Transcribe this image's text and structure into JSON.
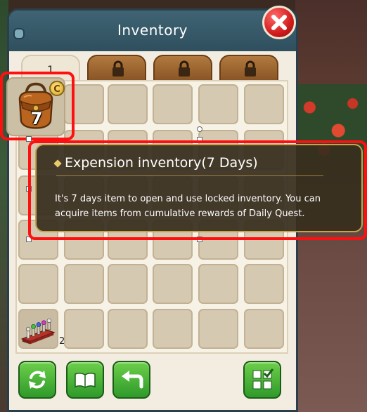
{
  "window": {
    "title": "Inventory",
    "close_icon": "close-x-icon"
  },
  "tabs": [
    {
      "label": "1",
      "locked": false
    },
    {
      "label": "",
      "locked": true,
      "icon": "padlock-icon"
    },
    {
      "label": "",
      "locked": true,
      "icon": "padlock-icon"
    },
    {
      "label": "",
      "locked": true,
      "icon": "padlock-icon"
    }
  ],
  "items": {
    "bag": {
      "icon": "leather-bag-icon",
      "count": "7",
      "badge": "C"
    },
    "rack": {
      "icon": "potion-rack-icon",
      "count": "2"
    }
  },
  "tooltip": {
    "title": "Expension inventory(7 Days)",
    "body": "It's 7 days item to open and use locked inventory. You can acquire items from cumulative rewards of Daily Quest."
  },
  "footer": {
    "buttons": [
      {
        "icon": "refresh-icon"
      },
      {
        "icon": "book-icon"
      },
      {
        "icon": "undo-arrow-icon"
      },
      {
        "icon": "grid-checkmark-icon"
      }
    ]
  },
  "colors": {
    "accent_green": "#3aa52e",
    "title_bar": "#2f4f5e",
    "close_red": "#d11c1c",
    "highlight_red": "#ff1010",
    "tooltip_gold": "#c7a34c"
  }
}
